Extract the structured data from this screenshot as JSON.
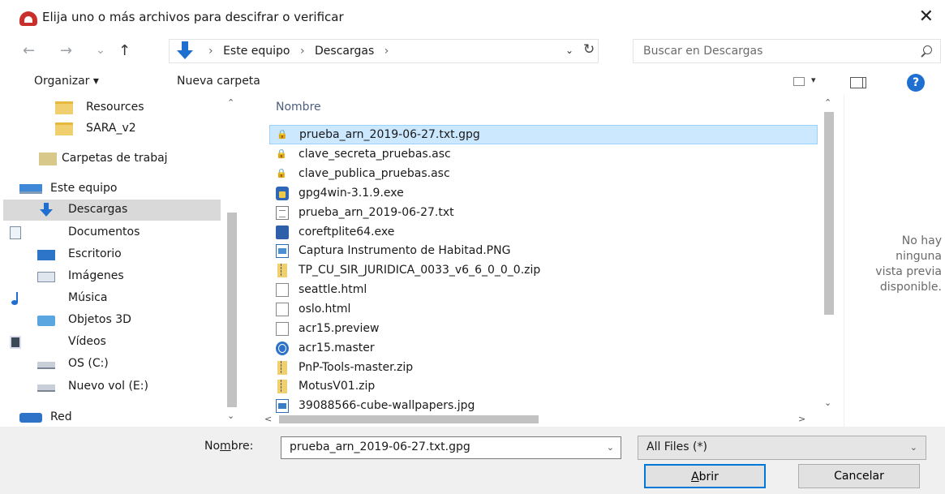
{
  "dialog": {
    "title": "Elija uno o más archivos para descifrar o verificar",
    "close_symbol": "✕"
  },
  "nav": {
    "back_symbol": "←",
    "forward_symbol": "→",
    "recent_symbol": "⌄",
    "up_symbol": "↑",
    "crumbs": [
      "Este equipo",
      "Descargas"
    ],
    "crumb_sep": "›",
    "dropdown_symbol": "⌄",
    "refresh_symbol": "↻",
    "search_placeholder": "Buscar en Descargas"
  },
  "toolbar": {
    "organize_label": "Organizar ▾",
    "new_folder_label": "Nueva carpeta",
    "view_dropdown": "▾",
    "help_label": "?"
  },
  "sidebar": {
    "items": [
      {
        "label": "Resources",
        "icon": "folder-icon"
      },
      {
        "label": "SARA_v2",
        "icon": "folder-icon"
      },
      {
        "label": "Carpetas de trabaj",
        "icon": "work-folders-icon"
      },
      {
        "label": "Este equipo",
        "icon": "computer-icon"
      },
      {
        "label": "Descargas",
        "icon": "downloads-icon",
        "selected": true
      },
      {
        "label": "Documentos",
        "icon": "documents-icon"
      },
      {
        "label": "Escritorio",
        "icon": "desktop-icon"
      },
      {
        "label": "Imágenes",
        "icon": "pictures-icon"
      },
      {
        "label": "Música",
        "icon": "music-icon"
      },
      {
        "label": "Objetos 3D",
        "icon": "3d-objects-icon"
      },
      {
        "label": "Vídeos",
        "icon": "videos-icon"
      },
      {
        "label": "OS (C:)",
        "icon": "drive-icon"
      },
      {
        "label": "Nuevo vol (E:)",
        "icon": "drive-icon"
      },
      {
        "label": "Red",
        "icon": "network-icon"
      }
    ]
  },
  "files": {
    "column_header": "Nombre",
    "rows": [
      {
        "name": "prueba_arn_2019-06-27.txt.gpg",
        "icon": "encrypted-file-icon",
        "selected": true
      },
      {
        "name": "clave_secreta_pruebas.asc",
        "icon": "key-file-icon"
      },
      {
        "name": "clave_publica_pruebas.asc",
        "icon": "key-file-icon"
      },
      {
        "name": "gpg4win-3.1.9.exe",
        "icon": "installer-icon"
      },
      {
        "name": "prueba_arn_2019-06-27.txt",
        "icon": "text-file-icon"
      },
      {
        "name": "coreftplite64.exe",
        "icon": "exe-icon"
      },
      {
        "name": "Captura Instrumento de Habitad.PNG",
        "icon": "image-file-icon"
      },
      {
        "name": "TP_CU_SIR_JURIDICA_0033_v6_6_0_0_0.zip",
        "icon": "zip-icon"
      },
      {
        "name": "seattle.html",
        "icon": "blank-file-icon"
      },
      {
        "name": "oslo.html",
        "icon": "blank-file-icon"
      },
      {
        "name": "acr15.preview",
        "icon": "blank-file-icon"
      },
      {
        "name": "acr15.master",
        "icon": "web-file-icon"
      },
      {
        "name": "PnP-Tools-master.zip",
        "icon": "zip-icon"
      },
      {
        "name": "MotusV01.zip",
        "icon": "zip-icon"
      },
      {
        "name": "39088566-cube-wallpapers.jpg",
        "icon": "image-file-icon"
      }
    ]
  },
  "preview": {
    "lines": [
      "No hay",
      "ninguna",
      "vista previa",
      "disponible."
    ]
  },
  "footer": {
    "name_label_pre": "No",
    "name_label_underlined": "m",
    "name_label_post": "bre:",
    "name_value": "prueba_arn_2019-06-27.txt.gpg",
    "name_dropdown": "⌄",
    "filter_value": "All Files (*)",
    "filter_dropdown": "⌄",
    "open_label_underlined": "A",
    "open_label_rest": "brir",
    "cancel_label": "Cancelar"
  },
  "scroll": {
    "up": "⌃",
    "down": "⌄",
    "left": "<",
    "right": ">"
  }
}
